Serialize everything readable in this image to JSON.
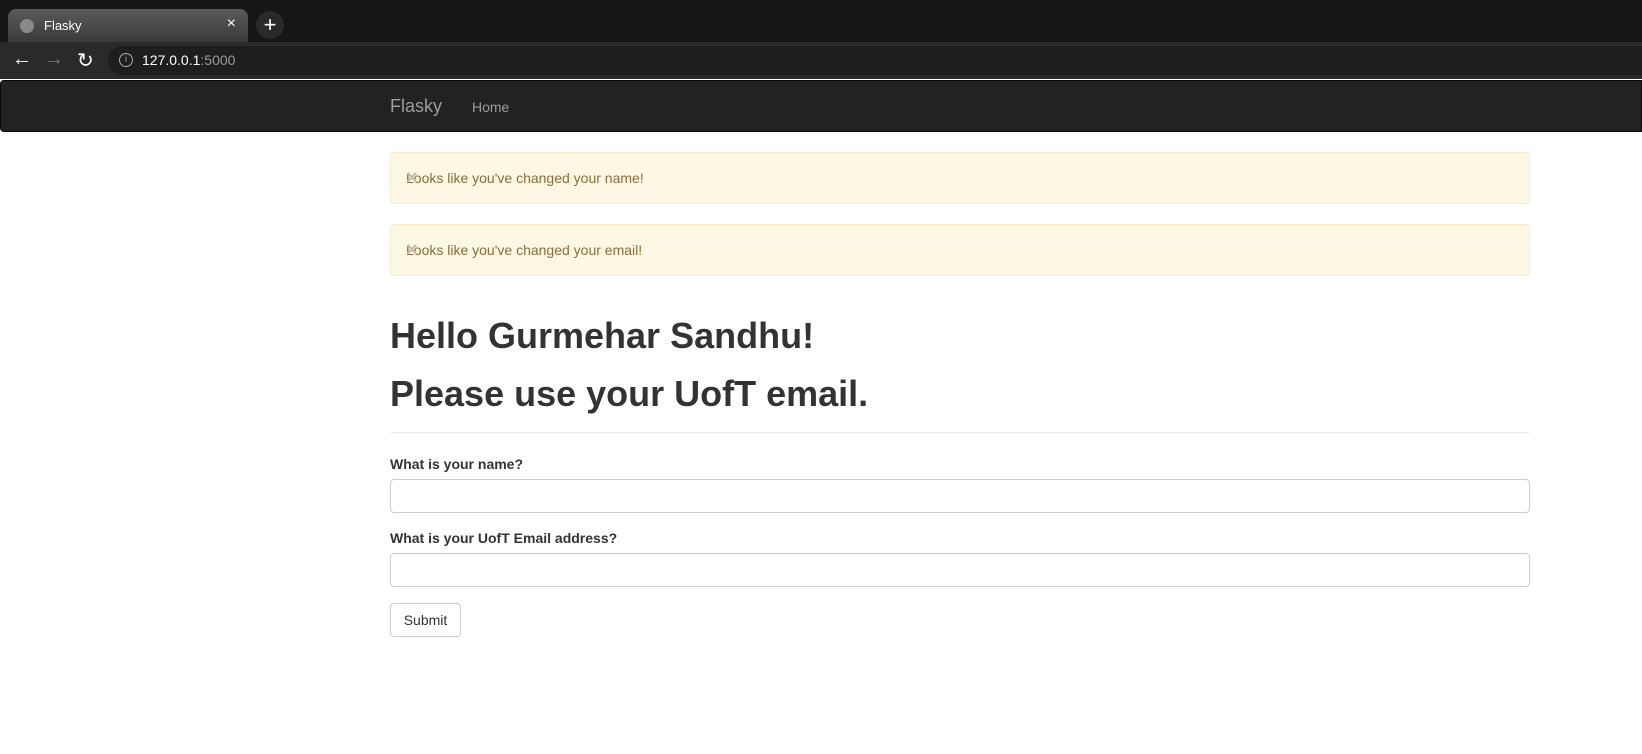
{
  "browser": {
    "tab_title": "Flasky",
    "close": "×",
    "new_tab": "+",
    "url_host": "127.0.0.1",
    "url_port": ":5000",
    "back": "←",
    "forward": "→",
    "reload": "↻",
    "info": "i"
  },
  "navbar": {
    "brand": "Flasky",
    "home": "Home"
  },
  "alerts": [
    {
      "text": "Looks like you've changed your name!",
      "close": "×"
    },
    {
      "text": "Looks like you've changed your email!",
      "close": "×"
    }
  ],
  "headings": {
    "greeting": "Hello Gurmehar Sandhu!",
    "instruction": "Please use your UofT email."
  },
  "form": {
    "name_label": "What is your name?",
    "name_value": "",
    "email_label": "What is your UofT Email address?",
    "email_value": "",
    "submit": "Submit"
  }
}
